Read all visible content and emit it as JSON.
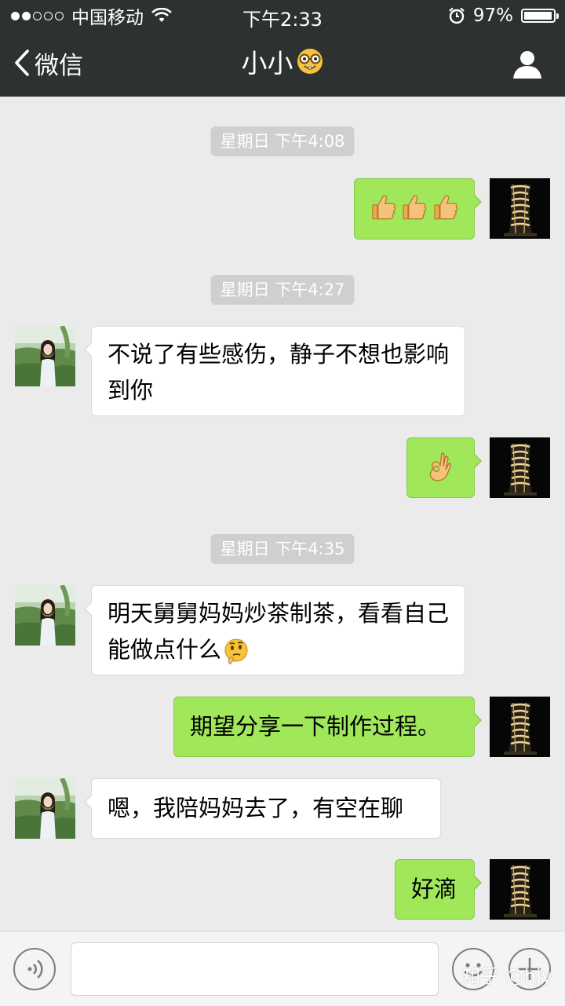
{
  "status_bar": {
    "carrier": "中国移动",
    "time": "下午2:33",
    "battery": "97%",
    "battery_level": 0.97,
    "signal_strength": 2
  },
  "nav": {
    "back_label": "微信",
    "title": "小小",
    "title_emoji": "nerd-face-emoji"
  },
  "messages": {
    "t1": "星期日 下午4:08",
    "m1_emoji": [
      "thumbs-up-emoji",
      "thumbs-up-emoji",
      "thumbs-up-emoji"
    ],
    "t2": "星期日 下午4:27",
    "m2": "不说了有些感伤，静子不想也影响到你",
    "m3_emoji": "ok-hand-emoji",
    "t3": "星期日 下午4:35",
    "m4": "明天舅舅妈妈炒茶制茶，看看自己能做点什么",
    "m4_emoji": "thinking-face-emoji",
    "m5": "期望分享一下制作过程。",
    "m6": "嗯，我陪妈妈去了，有空在聊",
    "m7": "好滴"
  },
  "colors": {
    "header_bg": "#2e3132",
    "chat_bg": "#ebebeb",
    "my_bubble": "#a0e75a",
    "their_bubble": "#ffffff"
  },
  "watermark": "知乎 @hjy"
}
